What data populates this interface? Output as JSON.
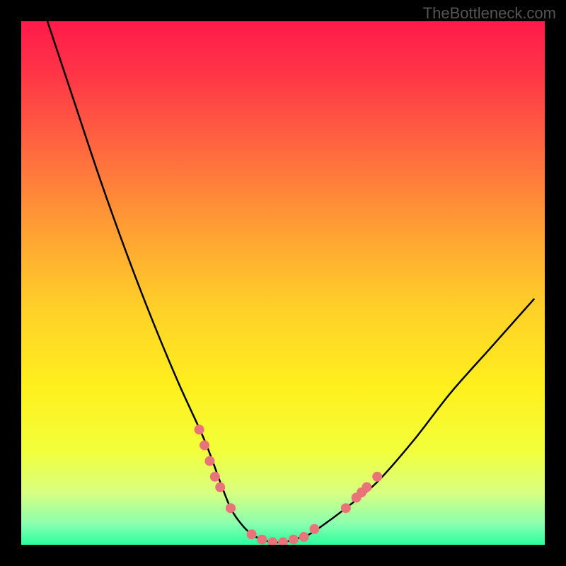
{
  "watermark": "TheBottleneck.com",
  "chart_data": {
    "type": "line",
    "title": "",
    "xlabel": "",
    "ylabel": "",
    "xlim": [
      0,
      100
    ],
    "ylim": [
      0,
      100
    ],
    "background_gradient": {
      "stops": [
        {
          "pos": 0.0,
          "color": "#ff1a4a"
        },
        {
          "pos": 0.1,
          "color": "#ff3547"
        },
        {
          "pos": 0.25,
          "color": "#ff6a3f"
        },
        {
          "pos": 0.4,
          "color": "#ffa033"
        },
        {
          "pos": 0.55,
          "color": "#ffd128"
        },
        {
          "pos": 0.7,
          "color": "#fff01e"
        },
        {
          "pos": 0.82,
          "color": "#f2ff3a"
        },
        {
          "pos": 0.9,
          "color": "#d8ff80"
        },
        {
          "pos": 0.96,
          "color": "#8affb0"
        },
        {
          "pos": 1.0,
          "color": "#2aff9e"
        }
      ]
    },
    "series": [
      {
        "name": "bottleneck-curve",
        "x": [
          5,
          10,
          15,
          20,
          25,
          30,
          35,
          38,
          40,
          42,
          44,
          46,
          48,
          50,
          52,
          55,
          58,
          62,
          68,
          75,
          82,
          90,
          98
        ],
        "y": [
          100,
          85,
          70,
          56,
          43,
          31,
          20,
          12,
          7,
          4,
          2,
          1,
          0.5,
          0.5,
          1,
          2,
          4,
          7,
          12,
          20,
          29,
          38,
          47
        ]
      }
    ],
    "markers": {
      "name": "highlight-dots",
      "color": "#e8747a",
      "points": [
        {
          "x": 34,
          "y": 22
        },
        {
          "x": 35,
          "y": 19
        },
        {
          "x": 36,
          "y": 16
        },
        {
          "x": 37,
          "y": 13
        },
        {
          "x": 38,
          "y": 11
        },
        {
          "x": 40,
          "y": 7
        },
        {
          "x": 44,
          "y": 2
        },
        {
          "x": 46,
          "y": 1
        },
        {
          "x": 48,
          "y": 0.5
        },
        {
          "x": 50,
          "y": 0.5
        },
        {
          "x": 52,
          "y": 1
        },
        {
          "x": 54,
          "y": 1.5
        },
        {
          "x": 56,
          "y": 3
        },
        {
          "x": 62,
          "y": 7
        },
        {
          "x": 64,
          "y": 9
        },
        {
          "x": 65,
          "y": 10
        },
        {
          "x": 66,
          "y": 11
        },
        {
          "x": 68,
          "y": 13
        }
      ]
    }
  }
}
